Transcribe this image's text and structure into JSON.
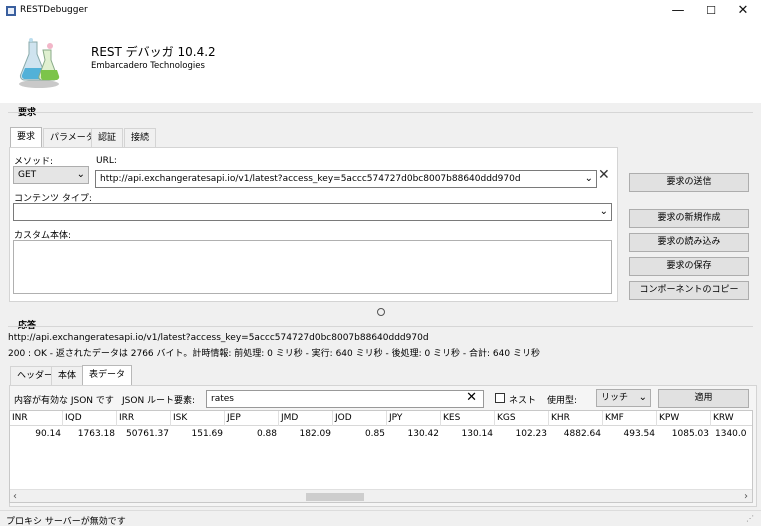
{
  "window": {
    "title": "RESTDebugger",
    "minimize": "—",
    "maximize": "☐",
    "close": "✕"
  },
  "header": {
    "product": "REST デバッガ 10.4.2",
    "company": "Embarcadero Technologies"
  },
  "request": {
    "section_title": "要求",
    "tabs": [
      "要求",
      "パラメータ",
      "認証",
      "接続"
    ],
    "method_label": "メソッド:",
    "method_value": "GET",
    "url_label": "URL:",
    "url_value": "http://api.exchangeratesapi.io/v1/latest?access_key=5accc574727d0bc8007b88640ddd970d",
    "content_type_label": "コンテンツ タイプ:",
    "content_type_value": "",
    "custom_body_label": "カスタム本体:",
    "custom_body_value": ""
  },
  "actions": {
    "send": "要求の送信",
    "new": "要求の新規作成",
    "load": "要求の読み込み",
    "save": "要求の保存",
    "copy_components": "コンポーネントのコピー"
  },
  "response": {
    "section_title": "応答",
    "url": "http://api.exchangeratesapi.io/v1/latest?access_key=5accc574727d0bc8007b88640ddd970d",
    "status": "200 : OK - 返されたデータは 2766 バイト。計時情報: 前処理: 0 ミリ秒 - 実行: 640 ミリ秒 - 後処理: 0 ミリ秒 - 合計: 640 ミリ秒",
    "tabs": [
      "ヘッダー",
      "本体",
      "表データ"
    ],
    "json_valid": "内容が有効な JSON です",
    "json_root_label": "JSON ルート要素:",
    "json_root_value": "rates",
    "nest_label": "ネスト",
    "use_type_label": "使用型:",
    "use_type_value": "リッチ",
    "apply": "適用"
  },
  "table": {
    "columns": [
      "INR",
      "IQD",
      "IRR",
      "ISK",
      "JEP",
      "JMD",
      "JOD",
      "JPY",
      "KES",
      "KGS",
      "KHR",
      "KMF",
      "KPW",
      "KRW"
    ],
    "rows": [
      [
        "90.14",
        "1763.18",
        "50761.37",
        "151.69",
        "0.88",
        "182.09",
        "0.85",
        "130.42",
        "130.14",
        "102.23",
        "4882.64",
        "493.54",
        "1085.03",
        "1340.0"
      ]
    ]
  },
  "statusbar": {
    "text": "プロキシ サーバーが無効です"
  },
  "colors": {
    "window_bg": "#f0f0f0",
    "panel_bg": "#ffffff",
    "button_bg": "#e1e1e1"
  }
}
